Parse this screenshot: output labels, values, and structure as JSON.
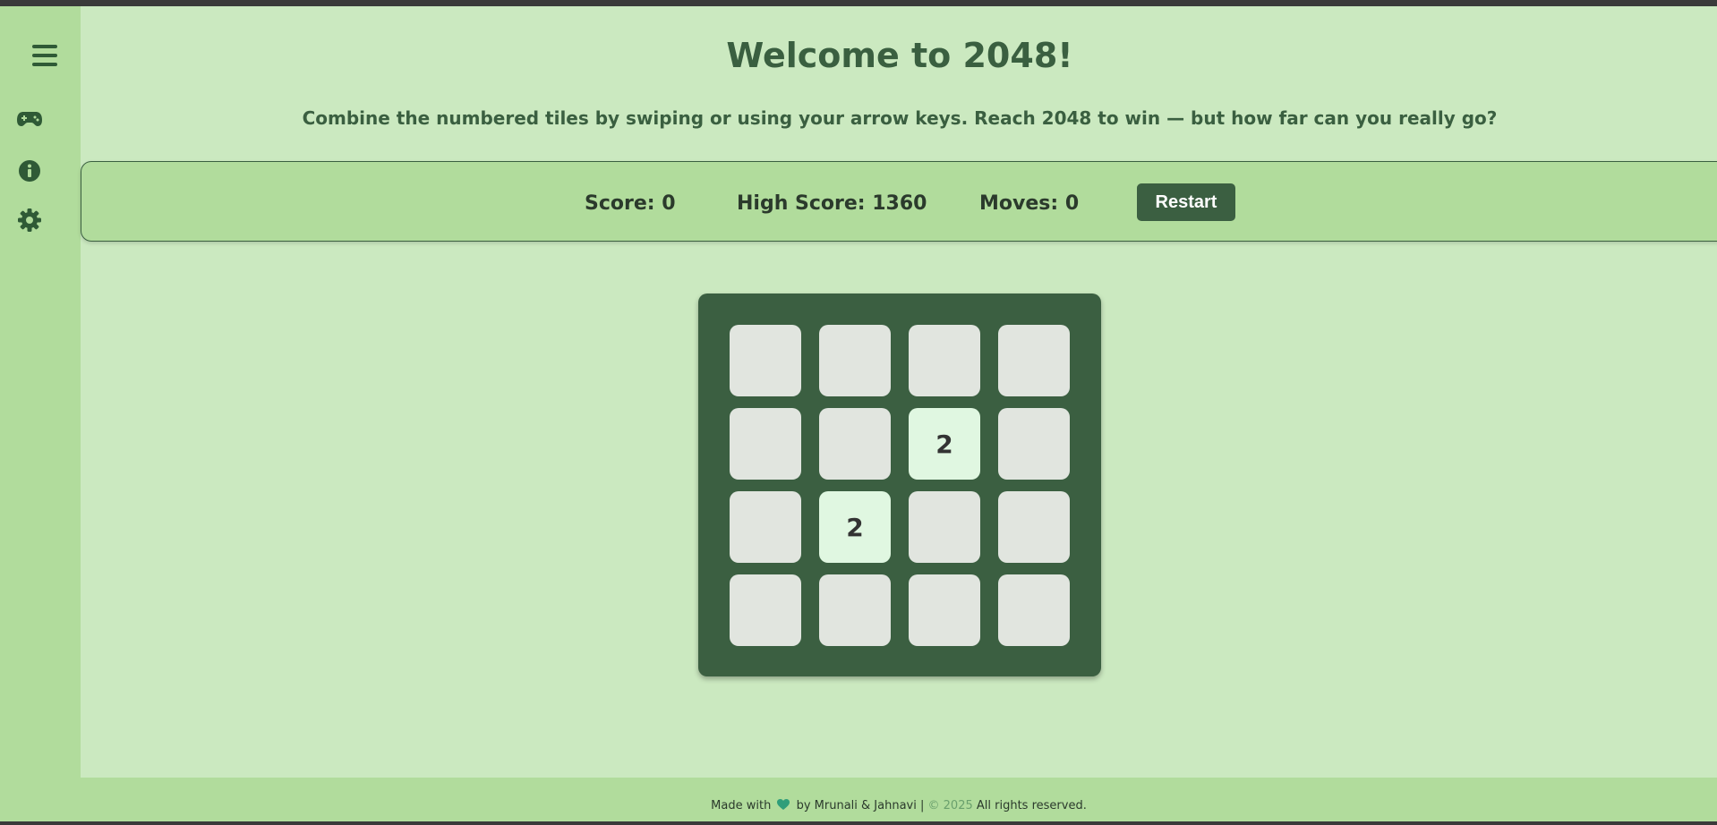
{
  "header": {
    "title": "Welcome to 2048!",
    "subtitle": "Combine the numbered tiles by swiping or using your arrow keys. Reach 2048 to win — but how far can you really go?"
  },
  "sidebar": {
    "icons": [
      "menu-icon",
      "gamepad-icon",
      "info-icon",
      "gear-icon"
    ]
  },
  "stats": {
    "score": "Score: 0",
    "high_score": "High Score: 1360",
    "moves": "Moves: 0",
    "restart_label": "Restart"
  },
  "board": {
    "size": 4,
    "tiles": [
      [
        "",
        "",
        "",
        ""
      ],
      [
        "",
        "",
        "2",
        ""
      ],
      [
        "",
        "2",
        "",
        ""
      ],
      [
        "",
        "",
        "",
        ""
      ]
    ]
  },
  "footer": {
    "made_with": "Made with",
    "by": "by Mrunali & Jahnavi |",
    "copyright": "© 2025",
    "rights": "All rights reserved."
  },
  "colors": {
    "background": "#cbe9c0",
    "panel": "#b1dc9c",
    "accent": "#3b5f41",
    "empty_tile": "#e1e5df",
    "filled_tile": "#e0f7e1",
    "heart": "#2f9e7a"
  }
}
